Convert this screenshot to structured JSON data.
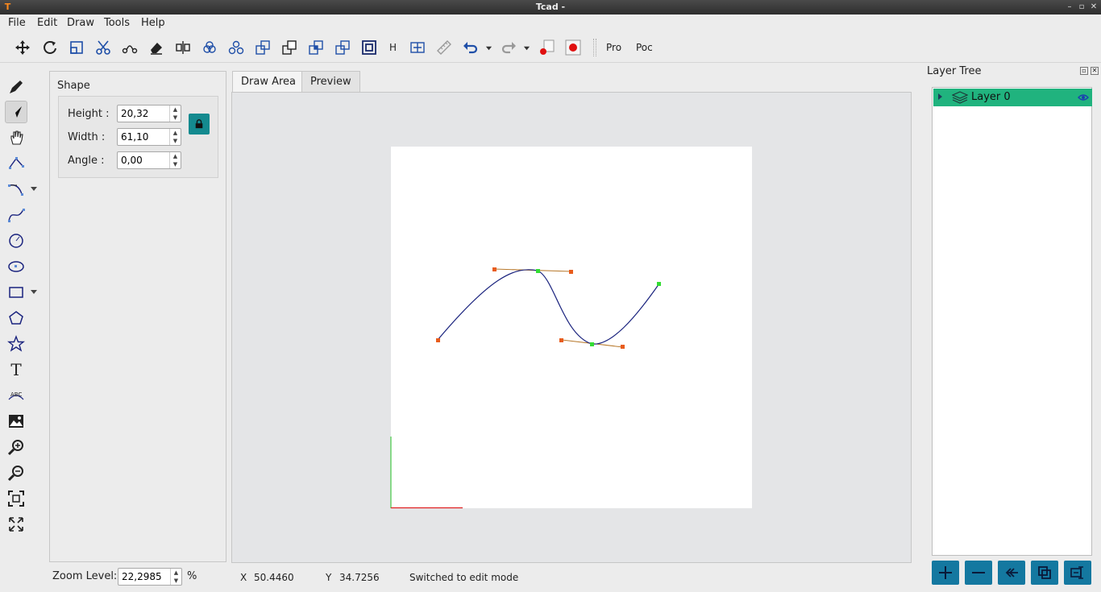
{
  "window": {
    "title": "Tcad -",
    "app_icon": "T"
  },
  "menu": [
    "File",
    "Edit",
    "Draw",
    "Tools",
    "Help"
  ],
  "toolbar": {
    "h_label": "H",
    "pro_label": "Pro",
    "poc_label": "Poc"
  },
  "shape_panel": {
    "title": "Shape",
    "height_label": "Height :",
    "height_value": "20,32",
    "width_label": "Width :",
    "width_value": "61,10",
    "angle_label": "Angle :",
    "angle_value": "0,00"
  },
  "tabs": [
    {
      "label": "Draw Area",
      "active": true
    },
    {
      "label": "Preview",
      "active": false
    }
  ],
  "left_tools": {
    "text_tool_glyph": "T",
    "text_path_glyph": "ABC",
    "active_tool": "select-tool"
  },
  "layer_tree": {
    "title": "Layer Tree",
    "layers": [
      {
        "name": "Layer 0",
        "visible": true
      }
    ]
  },
  "status": {
    "zoom_label": "Zoom Level:",
    "zoom_value": "22,2985",
    "zoom_unit": "%",
    "x_label": "X",
    "x_value": "50.4460",
    "y_label": "Y",
    "y_value": "34.7256",
    "message": "Switched to edit mode"
  },
  "colors": {
    "accent": "#148a8f",
    "layer_selected": "#20b37e",
    "layer_button": "#1478a0",
    "curve": "#1a237e",
    "handle_line": "#b87a2e",
    "anchor_node": "#33dd33",
    "control_node": "#e85c1c",
    "axis_x": "#e02020",
    "axis_y": "#20c020",
    "record": "#e01010"
  }
}
